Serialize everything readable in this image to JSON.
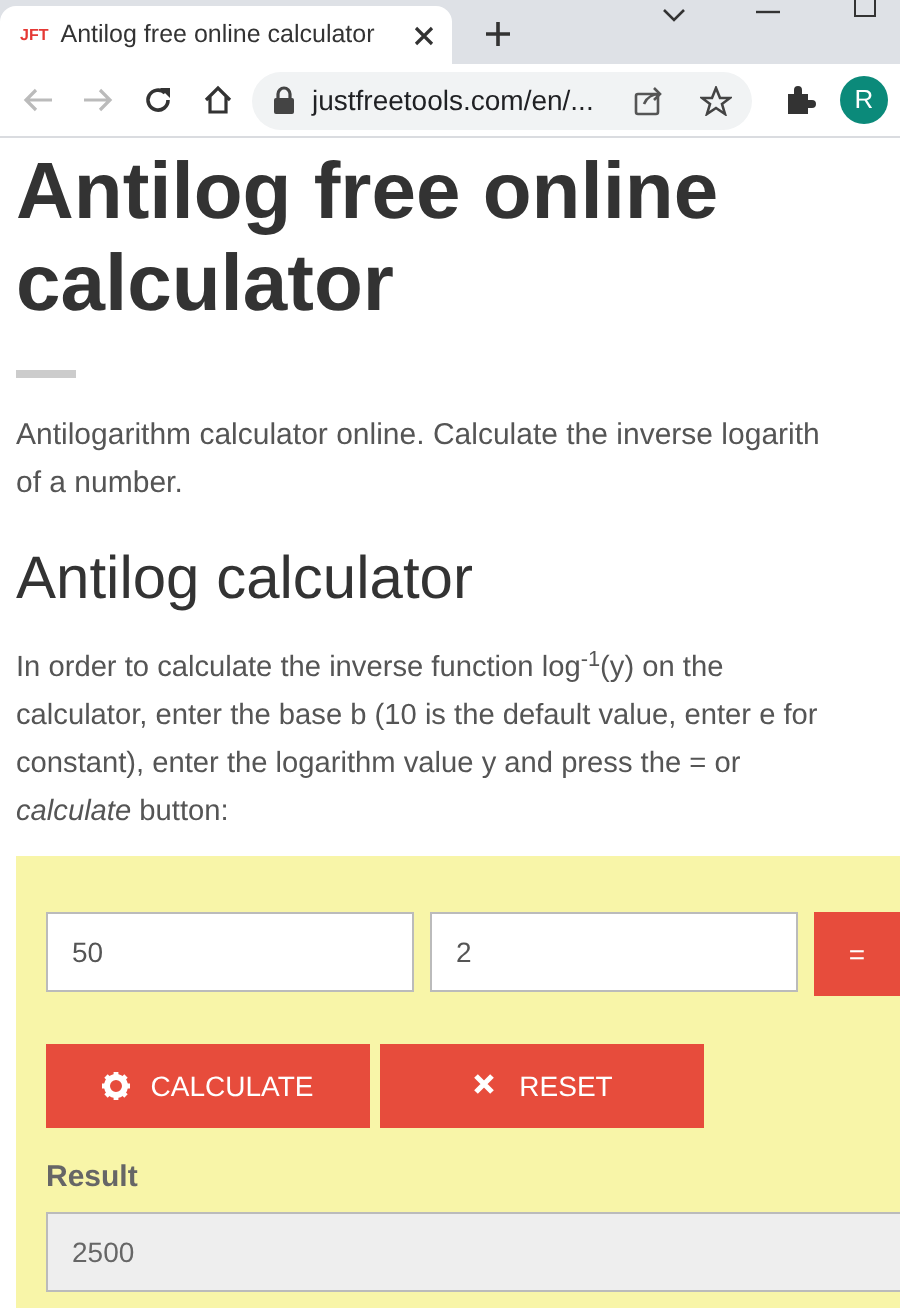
{
  "browser": {
    "tab": {
      "favicon_text": "JFT",
      "title": "Antilog free online calculator",
      "selected": true
    },
    "address": "justfreetools.com/en/...",
    "profile_initial": "R"
  },
  "page": {
    "title": "Antilog free online calculator",
    "intro": [
      "Antilogarithm calculator online. Calculate the inverse logarith",
      "of a number."
    ],
    "section_title": "Antilog calculator",
    "instructions": [
      "In order to calculate the inverse function log$^{-1}$(y) on the",
      "calculator, enter the base b (10 is the default value, enter e for",
      "constant), enter the logarithm value y and press the = or",
      "*calculate* button:"
    ],
    "calculator": {
      "base": "50",
      "value": "2",
      "equals_button": "=",
      "buttons": [
        {
          "kind": "calculate",
          "label": "CALCULATE"
        },
        {
          "kind": "reset",
          "label": "RESET"
        }
      ],
      "result_label": "Result",
      "result": "2500"
    }
  }
}
